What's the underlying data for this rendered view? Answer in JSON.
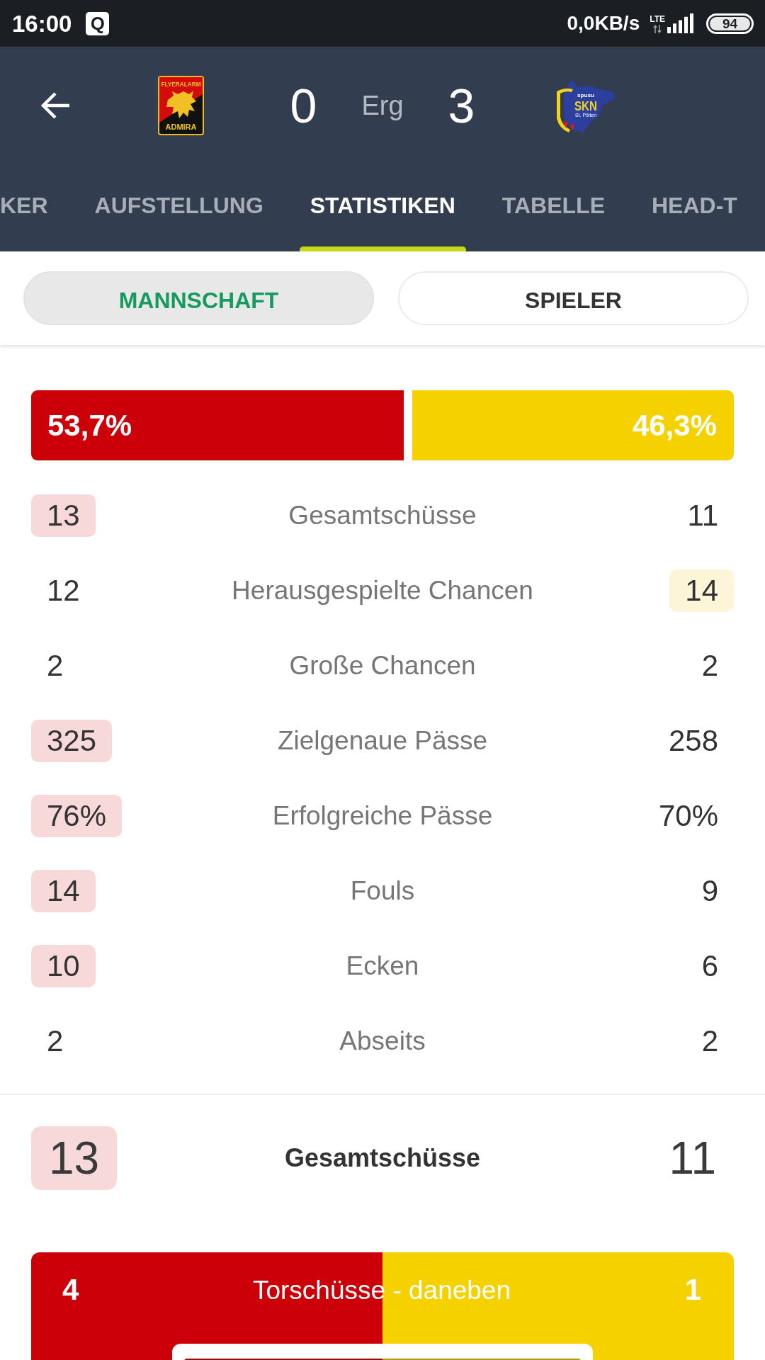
{
  "status_bar": {
    "time": "16:00",
    "notification_icon": "Q",
    "network_speed": "0,0KB/s",
    "network_type": "LTE",
    "battery": "94"
  },
  "match": {
    "home_team": {
      "crest_texts": [
        "FLYERALARM",
        "ADMIRA"
      ],
      "score": "0"
    },
    "status": "Erg",
    "away_team": {
      "crest_texts": [
        "spusu",
        "SKN",
        "St. Pölten"
      ],
      "score": "3"
    }
  },
  "tabs": [
    {
      "label": "KER",
      "selected": false
    },
    {
      "label": "AUFSTELLUNG",
      "selected": false
    },
    {
      "label": "STATISTIKEN",
      "selected": true
    },
    {
      "label": "TABELLE",
      "selected": false
    },
    {
      "label": "HEAD-T",
      "selected": false
    }
  ],
  "segments": [
    {
      "label": "MANNSCHAFT",
      "selected": true
    },
    {
      "label": "SPIELER",
      "selected": false
    }
  ],
  "possession": {
    "home": "53,7%",
    "away": "46,3%",
    "level": 0.537
  },
  "stats": [
    {
      "label": "Gesamtschüsse",
      "home": {
        "value": "13",
        "highlighted": true
      },
      "away": {
        "value": "11",
        "highlighted": false
      }
    },
    {
      "label": "Herausgespielte Chancen",
      "home": {
        "value": "12",
        "highlighted": false
      },
      "away": {
        "value": "14",
        "highlighted": true
      }
    },
    {
      "label": "Große Chancen",
      "home": {
        "value": "2",
        "highlighted": false
      },
      "away": {
        "value": "2",
        "highlighted": false
      }
    },
    {
      "label": "Zielgenaue Pässe",
      "home": {
        "value": "325",
        "highlighted": true
      },
      "away": {
        "value": "258",
        "highlighted": false
      }
    },
    {
      "label": "Erfolgreiche Pässe",
      "home": {
        "value": "76%",
        "highlighted": true
      },
      "away": {
        "value": "70%",
        "highlighted": false
      }
    },
    {
      "label": "Fouls",
      "home": {
        "value": "14",
        "highlighted": true
      },
      "away": {
        "value": "9",
        "highlighted": false
      }
    },
    {
      "label": "Ecken",
      "home": {
        "value": "10",
        "highlighted": true
      },
      "away": {
        "value": "6",
        "highlighted": false
      }
    },
    {
      "label": "Abseits",
      "home": {
        "value": "2",
        "highlighted": false
      },
      "away": {
        "value": "2",
        "highlighted": false
      }
    }
  ],
  "summary": {
    "label": "Gesamtschüsse",
    "home": {
      "value": "13",
      "highlighted": true
    },
    "away": {
      "value": "11",
      "highlighted": false
    }
  },
  "shot_breakdown": {
    "label": "Torschüsse - daneben",
    "home": "4",
    "away": "1"
  }
}
